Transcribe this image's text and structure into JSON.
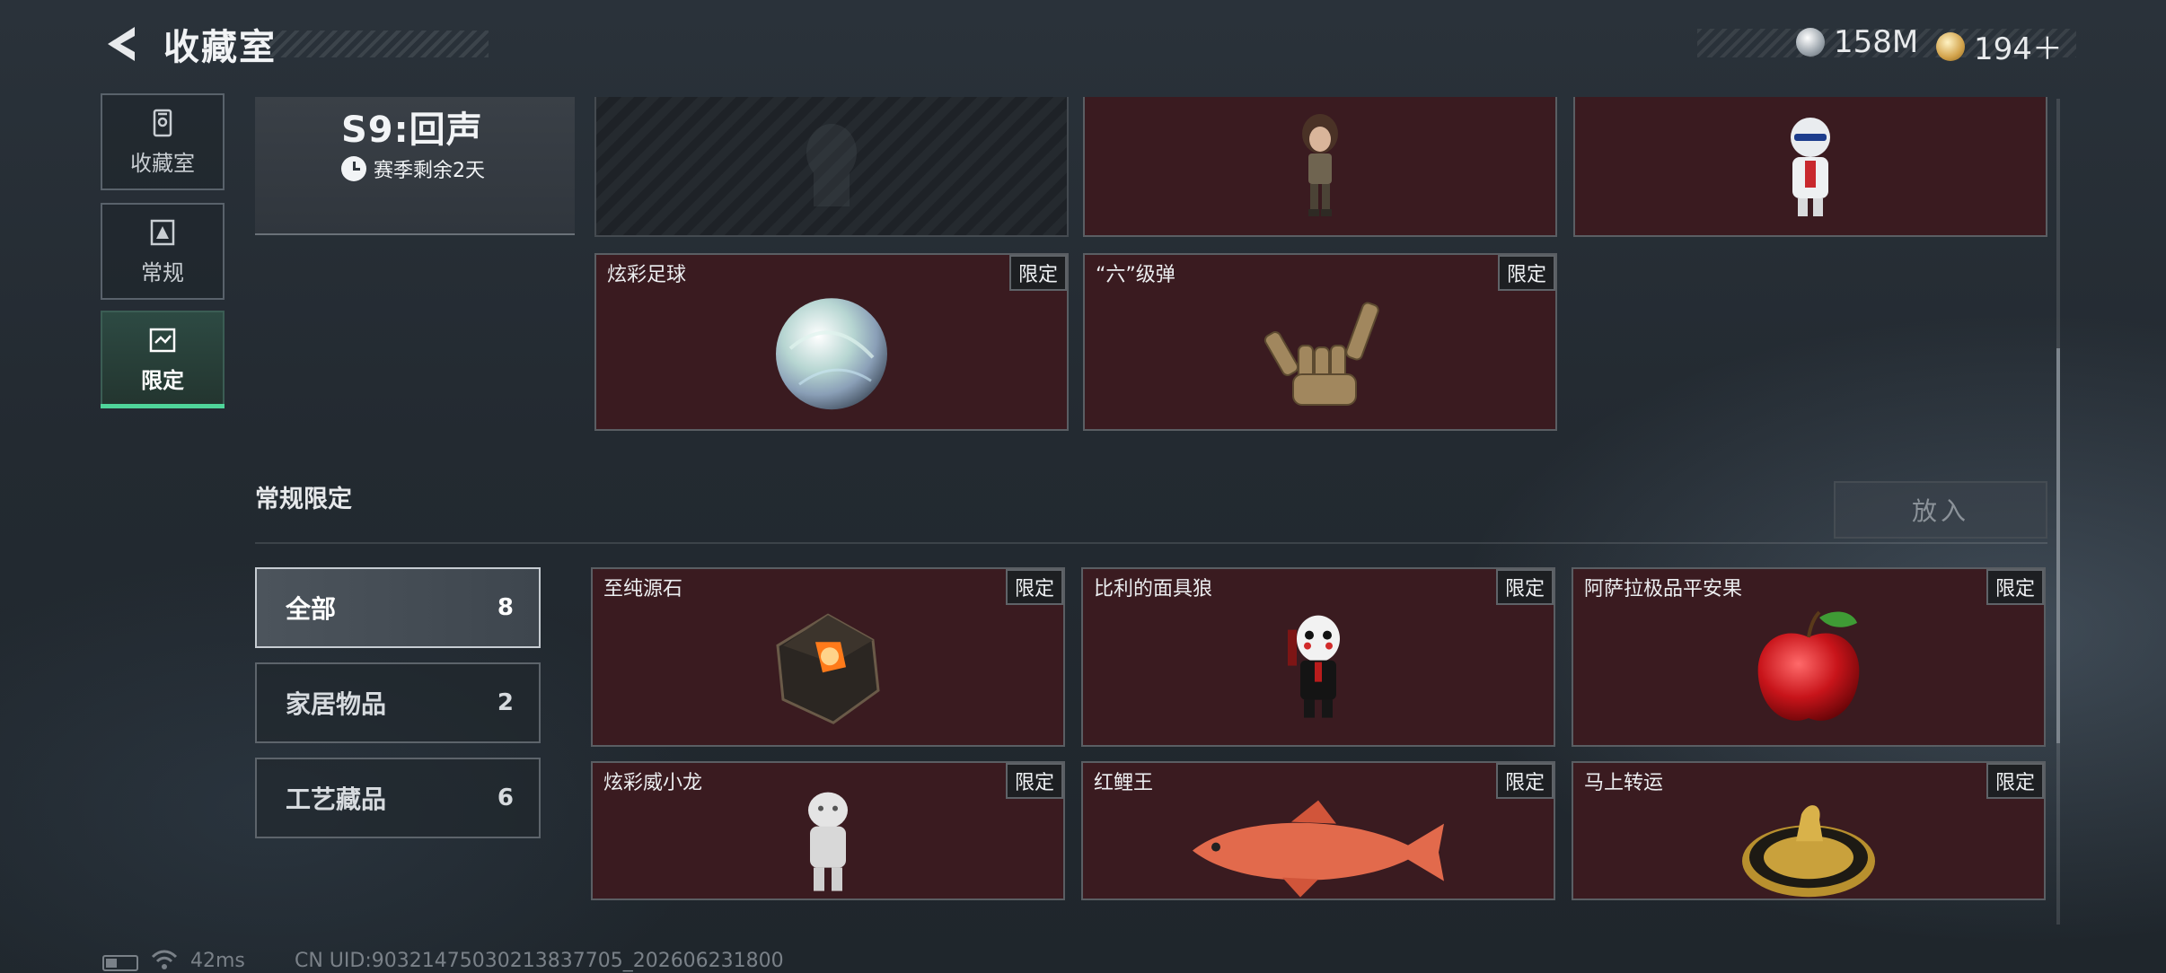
{
  "header": {
    "title": "收藏室",
    "currency": [
      {
        "icon": "silver-coin-icon",
        "value": "158M"
      },
      {
        "icon": "gold-coin-icon",
        "value": "194＋"
      }
    ]
  },
  "nav": {
    "items": [
      {
        "label": "收藏室",
        "icon": "collection-room-icon"
      },
      {
        "label": "常规",
        "icon": "regular-icon"
      },
      {
        "label": "限定",
        "icon": "limited-icon",
        "active": true
      }
    ]
  },
  "season": {
    "title": "S9:回声",
    "remaining": "赛季剩余2天"
  },
  "top_grid": {
    "cards": [
      {
        "name": "",
        "badge": ""
      },
      {
        "name": "",
        "badge": ""
      },
      {
        "name": "",
        "badge": ""
      },
      {
        "name": "炫彩足球",
        "badge": "限定"
      },
      {
        "name": "“六”级弹",
        "badge": "限定"
      }
    ]
  },
  "section": {
    "title": "常规限定",
    "put_button": "放入"
  },
  "filters": [
    {
      "label": "全部",
      "count": "8"
    },
    {
      "label": "家居物品",
      "count": "2"
    },
    {
      "label": "工艺藏品",
      "count": "6"
    }
  ],
  "items": [
    {
      "name": "至纯源石",
      "badge": "限定"
    },
    {
      "name": "比利的面具狼",
      "badge": "限定"
    },
    {
      "name": "阿萨拉极品平安果",
      "badge": "限定"
    },
    {
      "name": "炫彩威小龙",
      "badge": "限定"
    },
    {
      "name": "红鲤王",
      "badge": "限定"
    },
    {
      "name": "马上转运",
      "badge": "限定"
    }
  ],
  "status_bar": {
    "ping": "42ms",
    "uid": "CN UID:90321475030213837705_202606231800"
  },
  "colors": {
    "accent": "#4fd59a",
    "card_bg": "#3a1b20"
  }
}
